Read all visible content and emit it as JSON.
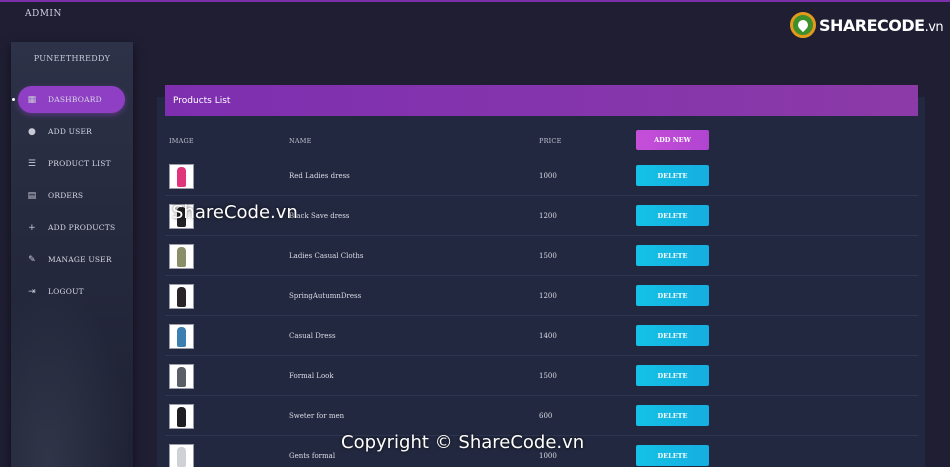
{
  "app": {
    "title": "ADMIN"
  },
  "logo": {
    "part1": "SHARE",
    "part2": "CODE",
    "part3": ".vn"
  },
  "sidebar": {
    "username": "PUNEETHREDDY",
    "items": [
      {
        "label": "DASHBOARD",
        "icon": "dashboard-icon",
        "glyph": "▦"
      },
      {
        "label": "ADD USER",
        "icon": "person-icon",
        "glyph": "●"
      },
      {
        "label": "PRODUCT LIST",
        "icon": "list-icon",
        "glyph": "☰"
      },
      {
        "label": "ORDERS",
        "icon": "library-icon",
        "glyph": "▤"
      },
      {
        "label": "ADD PRODUCTS",
        "icon": "plus-icon",
        "glyph": "+"
      },
      {
        "label": "MANAGE USER",
        "icon": "edit-icon",
        "glyph": "✎"
      },
      {
        "label": "LOGOUT",
        "icon": "logout-icon",
        "glyph": "⇥"
      }
    ]
  },
  "panel": {
    "title": "Products List",
    "columns": {
      "image": "IMAGE",
      "name": "NAME",
      "price": "PRICE"
    },
    "add_label": "ADD NEW",
    "delete_label": "DELETE",
    "products": [
      {
        "name": "Red Ladies dress",
        "price": "1000",
        "color": "#e0357a"
      },
      {
        "name": "Black Save dress",
        "price": "1200",
        "color": "#222226"
      },
      {
        "name": "Ladies Casual Cloths",
        "price": "1500",
        "color": "#8a8f6a"
      },
      {
        "name": "SpringAutumnDress",
        "price": "1200",
        "color": "#2a2428"
      },
      {
        "name": "Casual Dress",
        "price": "1400",
        "color": "#3c7fb0"
      },
      {
        "name": "Formal Look",
        "price": "1500",
        "color": "#5a5e66"
      },
      {
        "name": "Sweter for men",
        "price": "600",
        "color": "#1d1d22"
      },
      {
        "name": "Gents formal",
        "price": "1000",
        "color": "#cfd1d6"
      }
    ]
  },
  "watermark": {
    "mid": "ShareCode.vn",
    "bottom": "Copyright © ShareCode.vn"
  },
  "colors": {
    "accent": "#8e3fc4",
    "delete": "#14c2e6",
    "background": "#1f1e33"
  }
}
